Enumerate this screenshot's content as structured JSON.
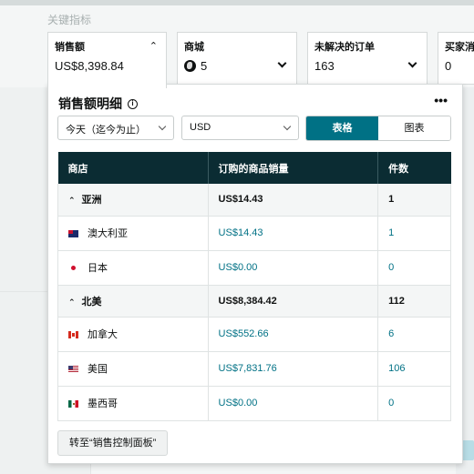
{
  "section_title": "关键指标",
  "metrics": [
    {
      "title": "销售额",
      "value": "US$8,398.84",
      "chevron": "chevron-up-icon"
    },
    {
      "title": "商城",
      "value": "5",
      "icon": "globe-icon",
      "chevron": "chevron-down-icon"
    },
    {
      "title": "未解决的订单",
      "value": "163",
      "chevron": "chevron-down-icon"
    },
    {
      "title": "买家消",
      "value": "0"
    }
  ],
  "popover": {
    "title": "销售额明细",
    "info_icon": "i",
    "more_icon": "•••",
    "date_select": "今天（迄今为止）",
    "currency_select": "USD",
    "view_toggle": {
      "table": "表格",
      "chart": "图表",
      "selected": "表格"
    },
    "table": {
      "headers": [
        "商店",
        "订购的商品销量",
        "件数"
      ],
      "rows": [
        {
          "type": "group",
          "name": "亚洲",
          "sales": "US$14.43",
          "units": "1"
        },
        {
          "type": "child",
          "flag": "australia-flag-icon",
          "name": "澳大利亚",
          "sales": "US$14.43",
          "units": "1"
        },
        {
          "type": "child",
          "flag": "japan-flag-icon",
          "name": "日本",
          "sales": "US$0.00",
          "units": "0"
        },
        {
          "type": "group",
          "name": "北美",
          "sales": "US$8,384.42",
          "units": "112"
        },
        {
          "type": "child",
          "flag": "canada-flag-icon",
          "name": "加拿大",
          "sales": "US$552.66",
          "units": "6"
        },
        {
          "type": "child",
          "flag": "usa-flag-icon",
          "name": "美国",
          "sales": "US$7,831.76",
          "units": "106"
        },
        {
          "type": "child",
          "flag": "mexico-flag-icon",
          "name": "墨西哥",
          "sales": "US$0.00",
          "units": "0"
        }
      ]
    },
    "goto_button": "转至“销售控制面板”"
  },
  "colors": {
    "accent": "#007185",
    "header_bg": "#0b2c33"
  }
}
